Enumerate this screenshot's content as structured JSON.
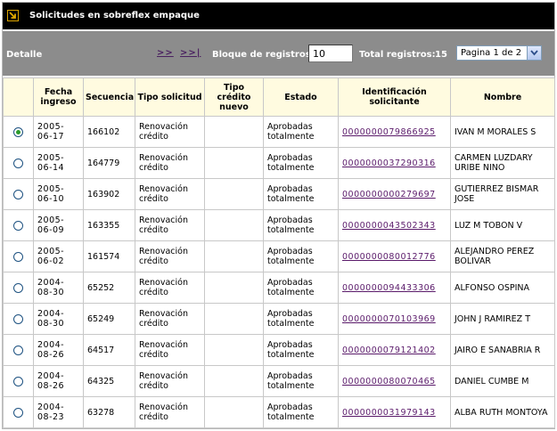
{
  "title": "Solicitudes en sobreflex empaque",
  "toolbar": {
    "detalle_label": "Detalle",
    "next_label": ">>",
    "last_label": ">>|",
    "block_label": "Bloque de registros:",
    "block_value": "10",
    "total_label": "Total registros:",
    "total_value": "15",
    "page_select_value": "Pagina 1 de 2"
  },
  "columns": {
    "fecha": "Fecha ingreso",
    "secuencia": "Secuencia",
    "tipo_solicitud": "Tipo solicitud",
    "tipo_credito": "Tipo crédito nuevo",
    "estado": "Estado",
    "identificacion": "Identificación solicitante",
    "nombre": "Nombre"
  },
  "rows": [
    {
      "selected": true,
      "fecha": "2005-06-17",
      "secuencia": "166102",
      "tipo_solicitud": "Renovación crédito",
      "tipo_credito": "",
      "estado": "Aprobadas totalmente",
      "identificacion": "0000000079866925",
      "nombre": "IVAN M MORALES S"
    },
    {
      "selected": false,
      "fecha": "2005-06-14",
      "secuencia": "164779",
      "tipo_solicitud": "Renovación crédito",
      "tipo_credito": "",
      "estado": "Aprobadas totalmente",
      "identificacion": "0000000037290316",
      "nombre": "CARMEN LUZDARY URIBE NINO"
    },
    {
      "selected": false,
      "fecha": "2005-06-10",
      "secuencia": "163902",
      "tipo_solicitud": "Renovación crédito",
      "tipo_credito": "",
      "estado": "Aprobadas totalmente",
      "identificacion": "0000000000279697",
      "nombre": "GUTIERREZ BISMAR JOSE"
    },
    {
      "selected": false,
      "fecha": "2005-06-09",
      "secuencia": "163355",
      "tipo_solicitud": "Renovación crédito",
      "tipo_credito": "",
      "estado": "Aprobadas totalmente",
      "identificacion": "0000000043502343",
      "nombre": "LUZ M TOBON V"
    },
    {
      "selected": false,
      "fecha": "2005-06-02",
      "secuencia": "161574",
      "tipo_solicitud": "Renovación crédito",
      "tipo_credito": "",
      "estado": "Aprobadas totalmente",
      "identificacion": "0000000080012776",
      "nombre": "ALEJANDRO PEREZ BOLIVAR"
    },
    {
      "selected": false,
      "fecha": "2004-08-30",
      "secuencia": "65252",
      "tipo_solicitud": "Renovación crédito",
      "tipo_credito": "",
      "estado": "Aprobadas totalmente",
      "identificacion": "0000000094433306",
      "nombre": "ALFONSO OSPINA"
    },
    {
      "selected": false,
      "fecha": "2004-08-30",
      "secuencia": "65249",
      "tipo_solicitud": "Renovación crédito",
      "tipo_credito": "",
      "estado": "Aprobadas totalmente",
      "identificacion": "0000000070103969",
      "nombre": "JOHN J RAMIREZ T"
    },
    {
      "selected": false,
      "fecha": "2004-08-26",
      "secuencia": "64517",
      "tipo_solicitud": "Renovación crédito",
      "tipo_credito": "",
      "estado": "Aprobadas totalmente",
      "identificacion": "0000000079121402",
      "nombre": "JAIRO E SANABRIA R"
    },
    {
      "selected": false,
      "fecha": "2004-08-26",
      "secuencia": "64325",
      "tipo_solicitud": "Renovación crédito",
      "tipo_credito": "",
      "estado": "Aprobadas totalmente",
      "identificacion": "0000000080070465",
      "nombre": "DANIEL CUMBE M"
    },
    {
      "selected": false,
      "fecha": "2004-08-23",
      "secuencia": "63278",
      "tipo_solicitud": "Renovación crédito",
      "tipo_credito": "",
      "estado": "Aprobadas totalmente",
      "identificacion": "0000000031979143",
      "nombre": "ALBA RUTH MONTOYA"
    }
  ],
  "colors": {
    "titlebar_bg": "#000000",
    "toolbar_bg": "#8c8c8c",
    "header_bg": "#fffbe0",
    "link": "#5a1a6a",
    "accent_icon": "#d9a200"
  },
  "icons": {
    "title_icon": "corner-arrow-icon",
    "select_arrow": "chevron-down-icon"
  }
}
